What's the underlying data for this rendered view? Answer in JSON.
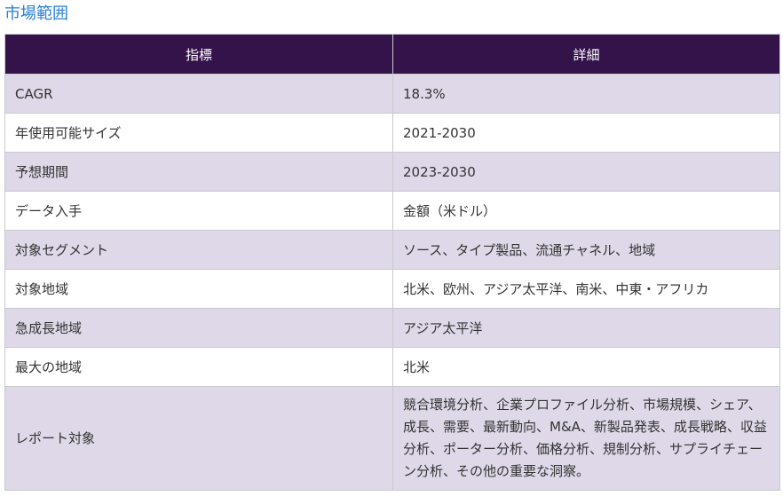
{
  "section": {
    "title": "市場範囲"
  },
  "table": {
    "headers": [
      "指標",
      "詳細"
    ],
    "rows": [
      {
        "metric": "CAGR",
        "detail": "18.3%"
      },
      {
        "metric": "年使用可能サイズ",
        "detail": "2021-2030"
      },
      {
        "metric": "予想期間",
        "detail": "2023-2030"
      },
      {
        "metric": "データ入手",
        "detail": "金額（米ドル）"
      },
      {
        "metric": "対象セグメント",
        "detail": "ソース、タイプ製品、流通チャネル、地域"
      },
      {
        "metric": "対象地域",
        "detail": "北米、欧州、アジア太平洋、南米、中東・アフリカ"
      },
      {
        "metric": "急成長地域",
        "detail": "アジア太平洋"
      },
      {
        "metric": "最大の地域",
        "detail": "北米"
      },
      {
        "metric": "レポート対象",
        "detail": "競合環境分析、企業プロファイル分析、市場規模、シェア、成長、需要、最新動向、M&A、新製品発表、成長戦略、収益分析、ポーター分析、価格分析、規制分析、サプライチェーン分析、その他の重要な洞察。"
      }
    ]
  }
}
